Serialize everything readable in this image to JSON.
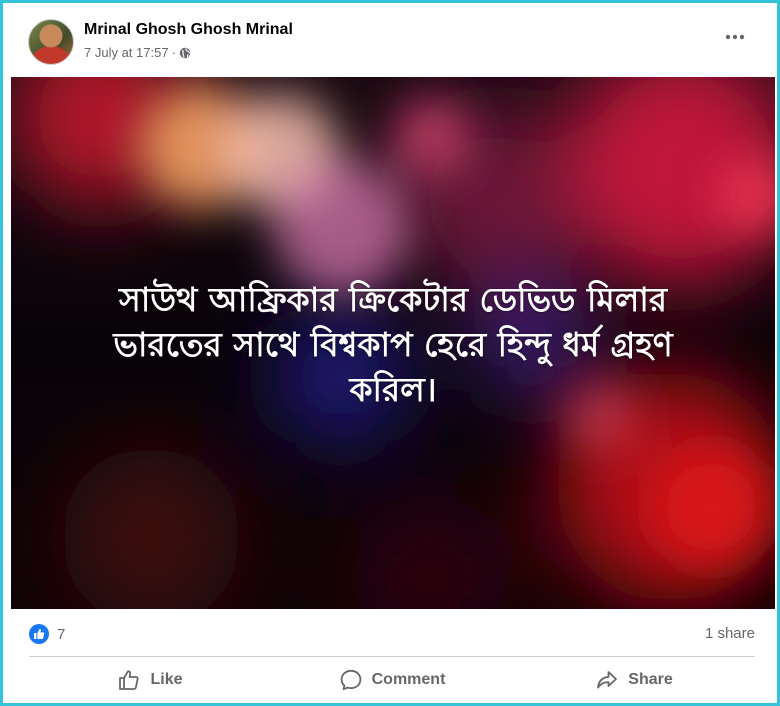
{
  "post": {
    "author": "Mrinal Ghosh Ghosh Mrinal",
    "timestamp": "7 July at 17:57",
    "separator": "·",
    "privacy_icon": "globe-icon",
    "menu_icon": "more-options-icon",
    "text_line_1": "সাউথ আফ্রিকার ক্রিকেটার ডেভিড মিলার",
    "text_line_2": "ভারতের সাথে বিশ্বকাপ হেরে হিন্দু ধর্ম গ্রহণ",
    "text_line_3": "করিল।"
  },
  "stats": {
    "reaction_icon": "like-reaction-icon",
    "reaction_count": "7",
    "shares": "1 share"
  },
  "actions": {
    "like": "Like",
    "comment": "Comment",
    "share": "Share"
  },
  "colors": {
    "frame_border": "#35c3d9",
    "like_blue": "#1877f2",
    "secondary_text": "#65676b",
    "primary_text": "#050505"
  }
}
